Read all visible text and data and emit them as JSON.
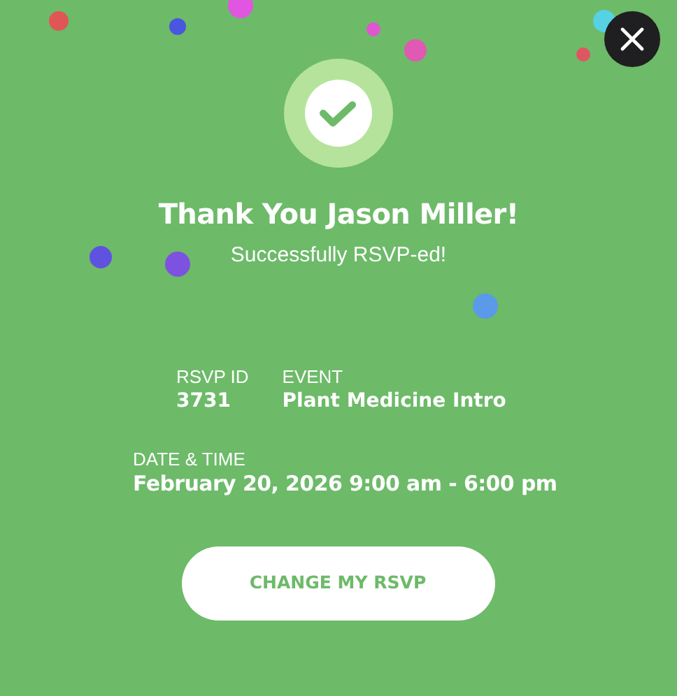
{
  "title": "Thank You Jason Miller!",
  "subtitle": "Successfully RSVP-ed!",
  "details": [
    {
      "label": "RSVP ID",
      "value": "3731"
    },
    {
      "label": "EVENT",
      "value": "Plant Medicine Intro"
    }
  ],
  "date_time": {
    "label": "DATE & TIME",
    "value": "February 20, 2026 9:00 am - 6:00 pm"
  },
  "button": "CHANGE MY RSVP"
}
